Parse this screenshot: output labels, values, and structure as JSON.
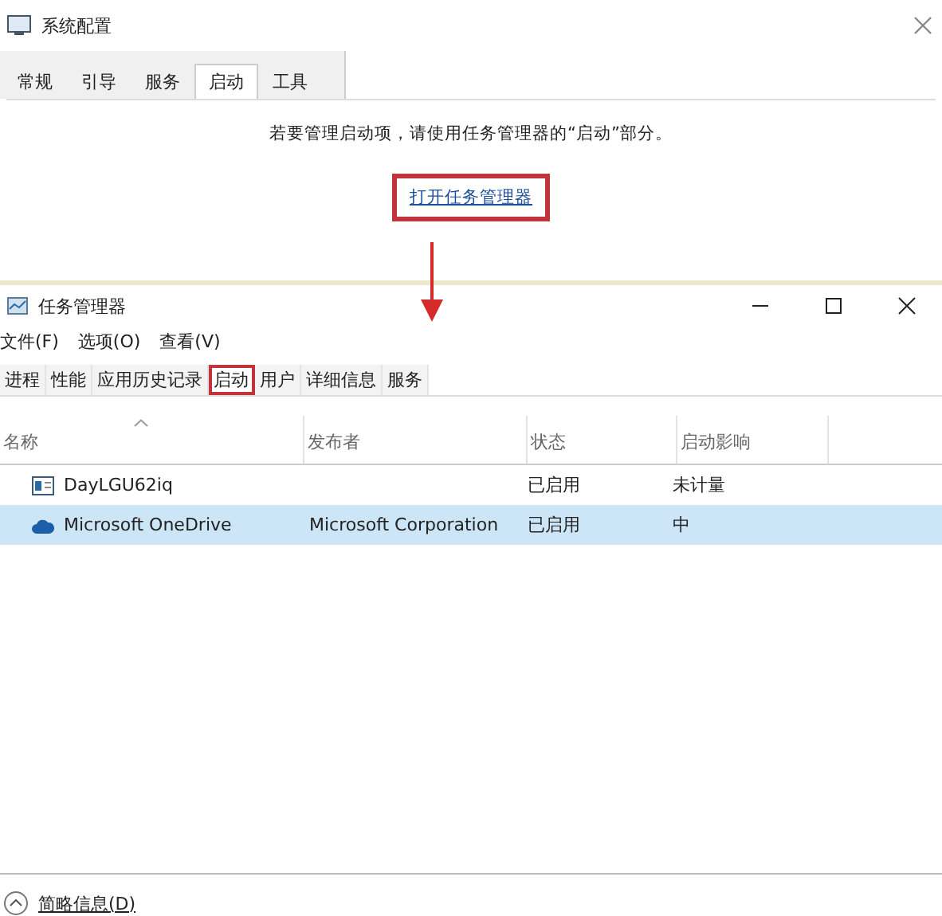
{
  "config_window": {
    "title": "系统配置",
    "tabs": [
      {
        "label": "常规",
        "selected": false
      },
      {
        "label": "引导",
        "selected": false
      },
      {
        "label": "服务",
        "selected": false
      },
      {
        "label": "启动",
        "selected": true
      },
      {
        "label": "工具",
        "selected": false
      }
    ],
    "message": "若要管理启动项，请使用任务管理器的“启动”部分。",
    "link": {
      "label": "打开任务管理器",
      "highlighted": true
    }
  },
  "task_manager": {
    "title": "任务管理器",
    "menu": [
      "文件(F)",
      "选项(O)",
      "查看(V)"
    ],
    "tabs": [
      {
        "label": "进程",
        "selected": false,
        "highlighted": false
      },
      {
        "label": "性能",
        "selected": false,
        "highlighted": false
      },
      {
        "label": "应用历史记录",
        "selected": false,
        "highlighted": false
      },
      {
        "label": "启动",
        "selected": true,
        "highlighted": true
      },
      {
        "label": "用户",
        "selected": false,
        "highlighted": false
      },
      {
        "label": "详细信息",
        "selected": false,
        "highlighted": false
      },
      {
        "label": "服务",
        "selected": false,
        "highlighted": false
      }
    ],
    "columns": [
      {
        "label": "名称",
        "sorted": true
      },
      {
        "label": "发布者",
        "sorted": false
      },
      {
        "label": "状态",
        "sorted": false
      },
      {
        "label": "启动影响",
        "sorted": false
      }
    ],
    "rows": [
      {
        "kind": "app",
        "cells": [
          "DayLGU62iq",
          "",
          "已启用",
          "未计量"
        ],
        "selected": false
      },
      {
        "kind": "cloud",
        "cells": [
          "Microsoft OneDrive",
          "Microsoft Corporation",
          "已启用",
          "中"
        ],
        "selected": true
      }
    ],
    "footer": "简略信息(D)"
  }
}
